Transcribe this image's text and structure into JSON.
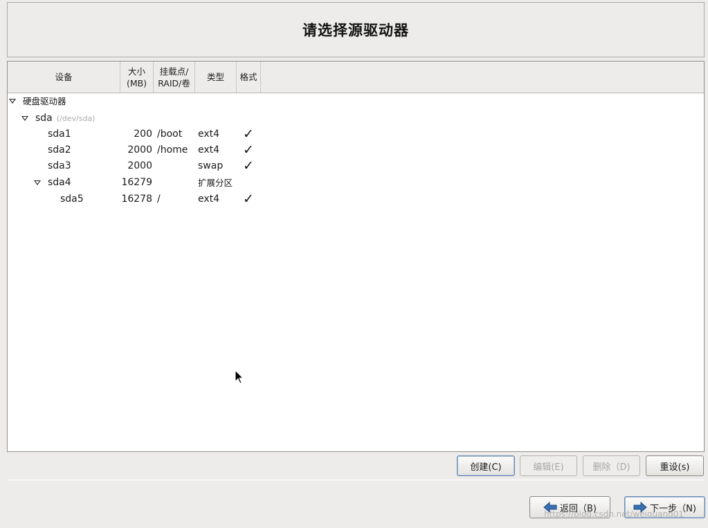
{
  "header": {
    "title": "请选择源驱动器"
  },
  "table": {
    "columns": {
      "device": "设备",
      "size": "大小\n(MB)",
      "mount": "挂载点/\nRAID/卷",
      "type": "类型",
      "format": "格式"
    },
    "rows": [
      {
        "device": "硬盘驱动器",
        "sub": "",
        "size": "",
        "mount": "",
        "type": "",
        "format": ""
      },
      {
        "device": "sda",
        "sub": "(/dev/sda)",
        "size": "",
        "mount": "",
        "type": "",
        "format": ""
      },
      {
        "device": "sda1",
        "sub": "",
        "size": "200",
        "mount": "/boot",
        "type": "ext4",
        "format": "✓"
      },
      {
        "device": "sda2",
        "sub": "",
        "size": "2000",
        "mount": "/home",
        "type": "ext4",
        "format": "✓"
      },
      {
        "device": "sda3",
        "sub": "",
        "size": "2000",
        "mount": "",
        "type": "swap",
        "format": "✓"
      },
      {
        "device": "sda4",
        "sub": "",
        "size": "16279",
        "mount": "",
        "type": "扩展分区",
        "format": ""
      },
      {
        "device": "sda5",
        "sub": "",
        "size": "16278",
        "mount": "/",
        "type": "ext4",
        "format": "✓"
      }
    ]
  },
  "actions": {
    "create": "创建(C)",
    "edit": "编辑(E)",
    "delete": "删除（D)",
    "reset": "重设(s)"
  },
  "nav": {
    "back": "返回（B)",
    "next": "下一步（N)"
  },
  "watermark": "https://blog.csdn.net/weiguang01",
  "colors": {
    "background": "#edeceb",
    "arrow": "#3a6fb0"
  }
}
